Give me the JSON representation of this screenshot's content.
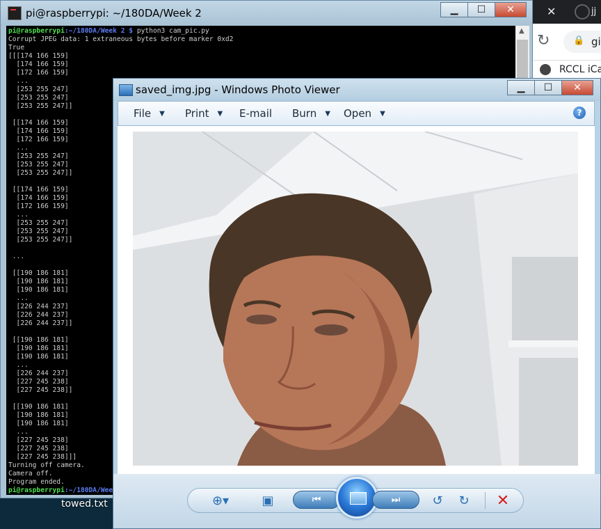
{
  "terminal": {
    "title": "pi@raspberrypi: ~/180DA/Week 2",
    "prompt_user": "pi@raspberrypi",
    "prompt_path": ":~/180DA/Week 2 $",
    "command": " python3 cam_pic.py",
    "output_lines": [
      "Corrupt JPEG data: 1 extraneous bytes before marker 0xd2",
      "True",
      "[[[174 166 159]",
      "  [174 166 159]",
      "  [172 166 159]",
      "  ...",
      "  [253 255 247]",
      "  [253 255 247]",
      "  [253 255 247]]",
      "",
      " [[174 166 159]",
      "  [174 166 159]",
      "  [172 166 159]",
      "  ...",
      "  [253 255 247]",
      "  [253 255 247]",
      "  [253 255 247]]",
      "",
      " [[174 166 159]",
      "  [174 166 159]",
      "  [172 166 159]",
      "  ...",
      "  [253 255 247]",
      "  [253 255 247]",
      "  [253 255 247]]",
      "",
      " ...",
      "",
      " [[190 186 181]",
      "  [190 186 181]",
      "  [190 186 181]",
      "  ...",
      "  [226 244 237]",
      "  [226 244 237]",
      "  [226 244 237]]",
      "",
      " [[190 186 181]",
      "  [190 186 181]",
      "  [190 186 181]",
      "  ...",
      "  [226 244 237]",
      "  [227 245 238]",
      "  [227 245 238]]",
      "",
      " [[190 186 181]",
      "  [190 186 181]",
      "  [190 186 181]",
      "  ...",
      "  [227 245 238]",
      "  [227 245 238]",
      "  [227 245 238]]]",
      "Turning off camera.",
      "Camera off.",
      "Program ended."
    ],
    "final_prompt_path": ":~/180DA/Wee"
  },
  "viewer": {
    "title": "saved_img.jpg - Windows Photo Viewer",
    "menu": [
      "File",
      "Print",
      "E-mail",
      "Burn",
      "Open"
    ],
    "menu_has_caret": [
      true,
      true,
      false,
      true,
      true
    ],
    "help": "?"
  },
  "browser": {
    "tab_text": "jj",
    "omnibox_text": "gi",
    "bookmark_text": "RCCL iCa"
  },
  "desktop": {
    "file_label": "towed.txt"
  },
  "icons": {
    "minimize": "minimize-icon",
    "maximize": "maximize-icon",
    "close": "close-icon",
    "zoom": "zoom-icon",
    "fit": "actual-size-icon",
    "prev": "previous-icon",
    "slideshow": "slideshow-icon",
    "next": "next-icon",
    "rotate_ccw": "rotate-counterclockwise-icon",
    "rotate_cw": "rotate-clockwise-icon",
    "delete": "delete-icon"
  }
}
